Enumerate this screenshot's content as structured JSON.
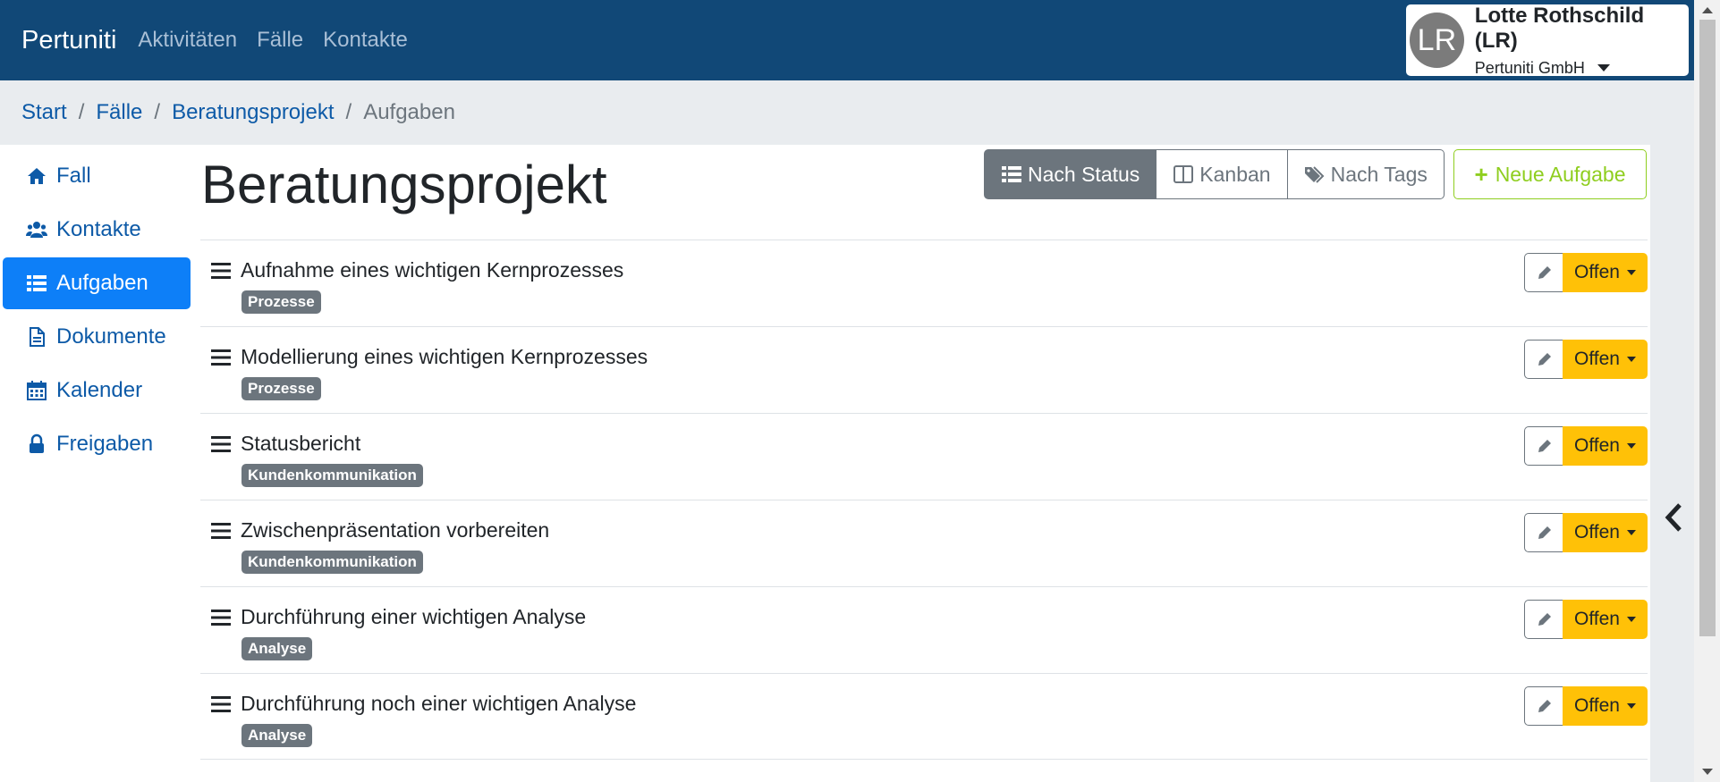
{
  "navbar": {
    "brand": "Pertuniti",
    "links": [
      "Aktivitäten",
      "Fälle",
      "Kontakte"
    ]
  },
  "user": {
    "initials": "LR",
    "name": "Lotte Rothschild (LR)",
    "company": "Pertuniti GmbH"
  },
  "breadcrumb": {
    "items": [
      "Start",
      "Fälle",
      "Beratungsprojekt"
    ],
    "active": "Aufgaben"
  },
  "sidebar": {
    "items": [
      {
        "label": "Fall",
        "icon": "home-icon"
      },
      {
        "label": "Kontakte",
        "icon": "users-icon"
      },
      {
        "label": "Aufgaben",
        "icon": "list-icon",
        "active": true
      },
      {
        "label": "Dokumente",
        "icon": "document-icon"
      },
      {
        "label": "Kalender",
        "icon": "calendar-icon"
      },
      {
        "label": "Freigaben",
        "icon": "lock-icon"
      }
    ]
  },
  "main": {
    "title": "Beratungsprojekt",
    "view_buttons": [
      {
        "label": "Nach Status",
        "icon": "list-icon",
        "active": true
      },
      {
        "label": "Kanban",
        "icon": "columns-icon"
      },
      {
        "label": "Nach Tags",
        "icon": "tags-icon"
      }
    ],
    "new_task_label": "Neue Aufgabe"
  },
  "tasks": [
    {
      "title": "Aufnahme eines wichtigen Kernprozesses",
      "tag": "Prozesse",
      "status": "Offen"
    },
    {
      "title": "Modellierung eines wichtigen Kernprozesses",
      "tag": "Prozesse",
      "status": "Offen"
    },
    {
      "title": "Statusbericht",
      "tag": "Kundenkommunikation",
      "status": "Offen"
    },
    {
      "title": "Zwischenpräsentation vorbereiten",
      "tag": "Kundenkommunikation",
      "status": "Offen"
    },
    {
      "title": "Durchführung einer wichtigen Analyse",
      "tag": "Analyse",
      "status": "Offen"
    },
    {
      "title": "Durchführung noch einer wichtigen Analyse",
      "tag": "Analyse",
      "status": "Offen"
    }
  ],
  "colors": {
    "navbar": "#114877",
    "primary": "#0d7ff8",
    "link": "#0d5aa7",
    "status_open": "#ffc107",
    "success": "#8fce1f",
    "secondary": "#6c757d"
  }
}
